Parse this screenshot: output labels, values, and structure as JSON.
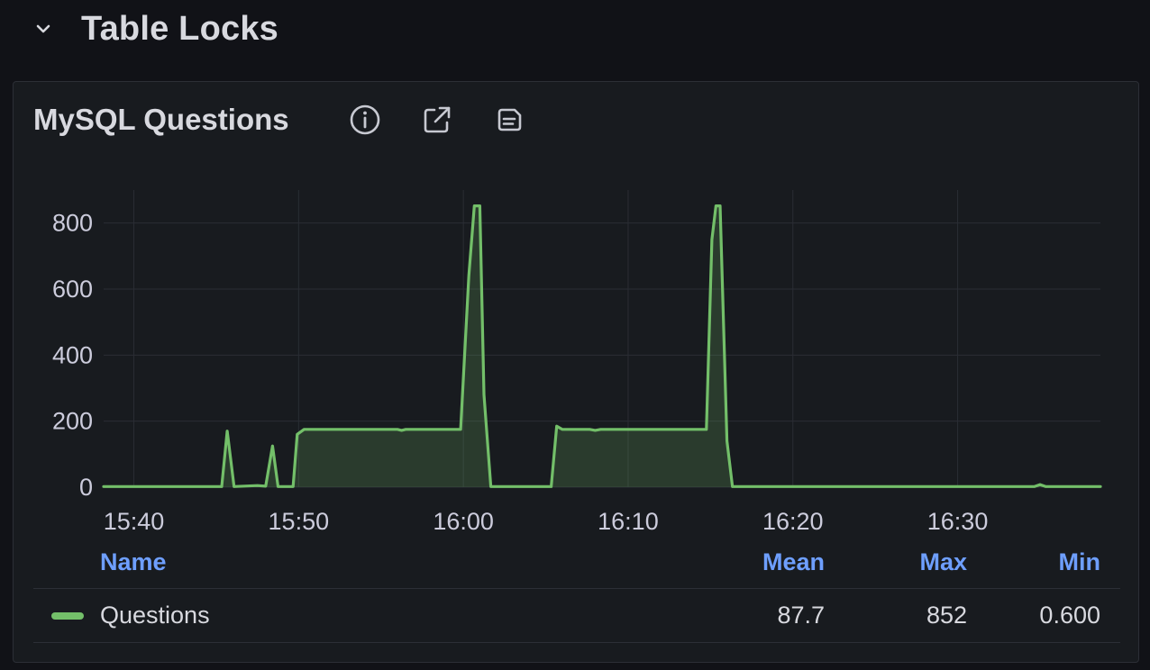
{
  "row": {
    "title": "Table Locks",
    "chevron_icon": "chevron-down-icon"
  },
  "panel": {
    "title": "MySQL Questions",
    "icons": [
      "info-icon",
      "external-link-icon",
      "panel-notes-icon"
    ]
  },
  "colors": {
    "series": "#73bf69",
    "legend_header": "#6e9fff",
    "background": "#111217",
    "panel": "#181b1f"
  },
  "legend": {
    "headers": {
      "name": "Name",
      "mean": "Mean",
      "max": "Max",
      "min": "Min"
    },
    "rows": [
      {
        "name": "Questions",
        "mean": "87.7",
        "max": "852",
        "min": "0.600"
      }
    ]
  },
  "chart_data": {
    "type": "area",
    "title": "MySQL Questions",
    "xlabel": "",
    "ylabel": "",
    "x_tick_labels": [
      "15:40",
      "15:50",
      "16:00",
      "16:10",
      "16:20",
      "16:30"
    ],
    "y_tick_labels": [
      "0",
      "200",
      "400",
      "600",
      "800"
    ],
    "y_ticks": [
      0,
      200,
      400,
      600,
      800
    ],
    "ylim": [
      0,
      900
    ],
    "xlim": [
      "15:38:10",
      "16:38:40"
    ],
    "grid": true,
    "legend_placement": "bottom table",
    "series": [
      {
        "name": "Questions",
        "color": "#73bf69",
        "fill": true,
        "x": [
          "15:38:10",
          "15:45:20",
          "15:45:40",
          "15:46:05",
          "15:47:30",
          "15:48:00",
          "15:48:25",
          "15:48:45",
          "15:49:10",
          "15:49:40",
          "15:49:55",
          "15:50:20",
          "15:56:00",
          "15:56:15",
          "15:56:30",
          "15:59:50",
          "16:00:20",
          "16:00:40",
          "16:01:00",
          "16:01:15",
          "16:01:40",
          "16:05:20",
          "16:05:40",
          "16:06:00",
          "16:07:40",
          "16:08:00",
          "16:08:20",
          "16:14:45",
          "16:15:05",
          "16:15:20",
          "16:15:35",
          "16:16:00",
          "16:16:20",
          "16:16:40",
          "16:34:40",
          "16:35:00",
          "16:35:20",
          "16:38:40"
        ],
        "values": [
          2,
          2,
          170,
          2,
          5,
          3,
          125,
          2,
          2,
          2,
          160,
          175,
          175,
          172,
          175,
          175,
          640,
          852,
          852,
          280,
          2,
          2,
          185,
          175,
          175,
          172,
          175,
          175,
          750,
          852,
          852,
          140,
          2,
          2,
          2,
          8,
          2,
          2
        ]
      }
    ]
  }
}
